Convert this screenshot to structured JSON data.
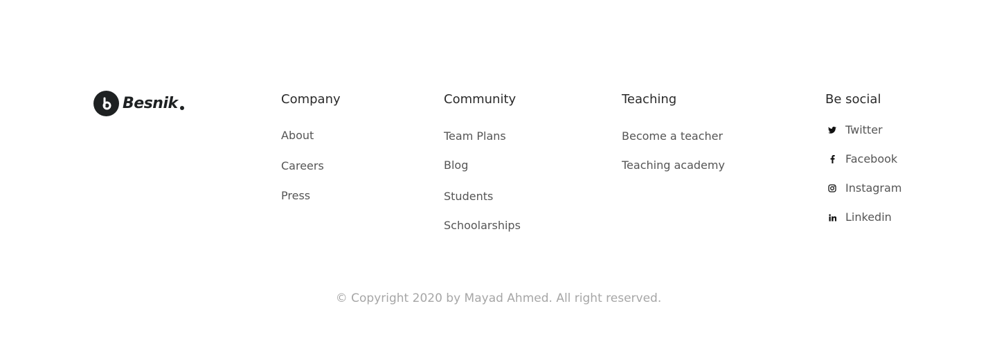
{
  "brand": {
    "name": "Besnik"
  },
  "columns": {
    "company": {
      "title": "Company",
      "links": [
        "About",
        "Careers",
        "Press"
      ]
    },
    "community": {
      "title": "Community",
      "links": [
        "Team Plans",
        "Blog",
        "Students",
        "Schoolarships"
      ]
    },
    "teaching": {
      "title": "Teaching",
      "links": [
        "Become a teacher",
        "Teaching academy"
      ]
    },
    "social": {
      "title": "Be social",
      "links": [
        {
          "label": "Twitter",
          "icon": "twitter-icon"
        },
        {
          "label": "Facebook",
          "icon": "facebook-icon"
        },
        {
          "label": "Instagram",
          "icon": "instagram-icon"
        },
        {
          "label": "Linkedin",
          "icon": "linkedin-icon"
        }
      ]
    }
  },
  "copyright": "© Copyright 2020 by Mayad Ahmed. All right reserved.",
  "colors": {
    "brand_dark": "#1e2122",
    "link_text": "#555555",
    "muted_text": "#a6a6a6"
  }
}
